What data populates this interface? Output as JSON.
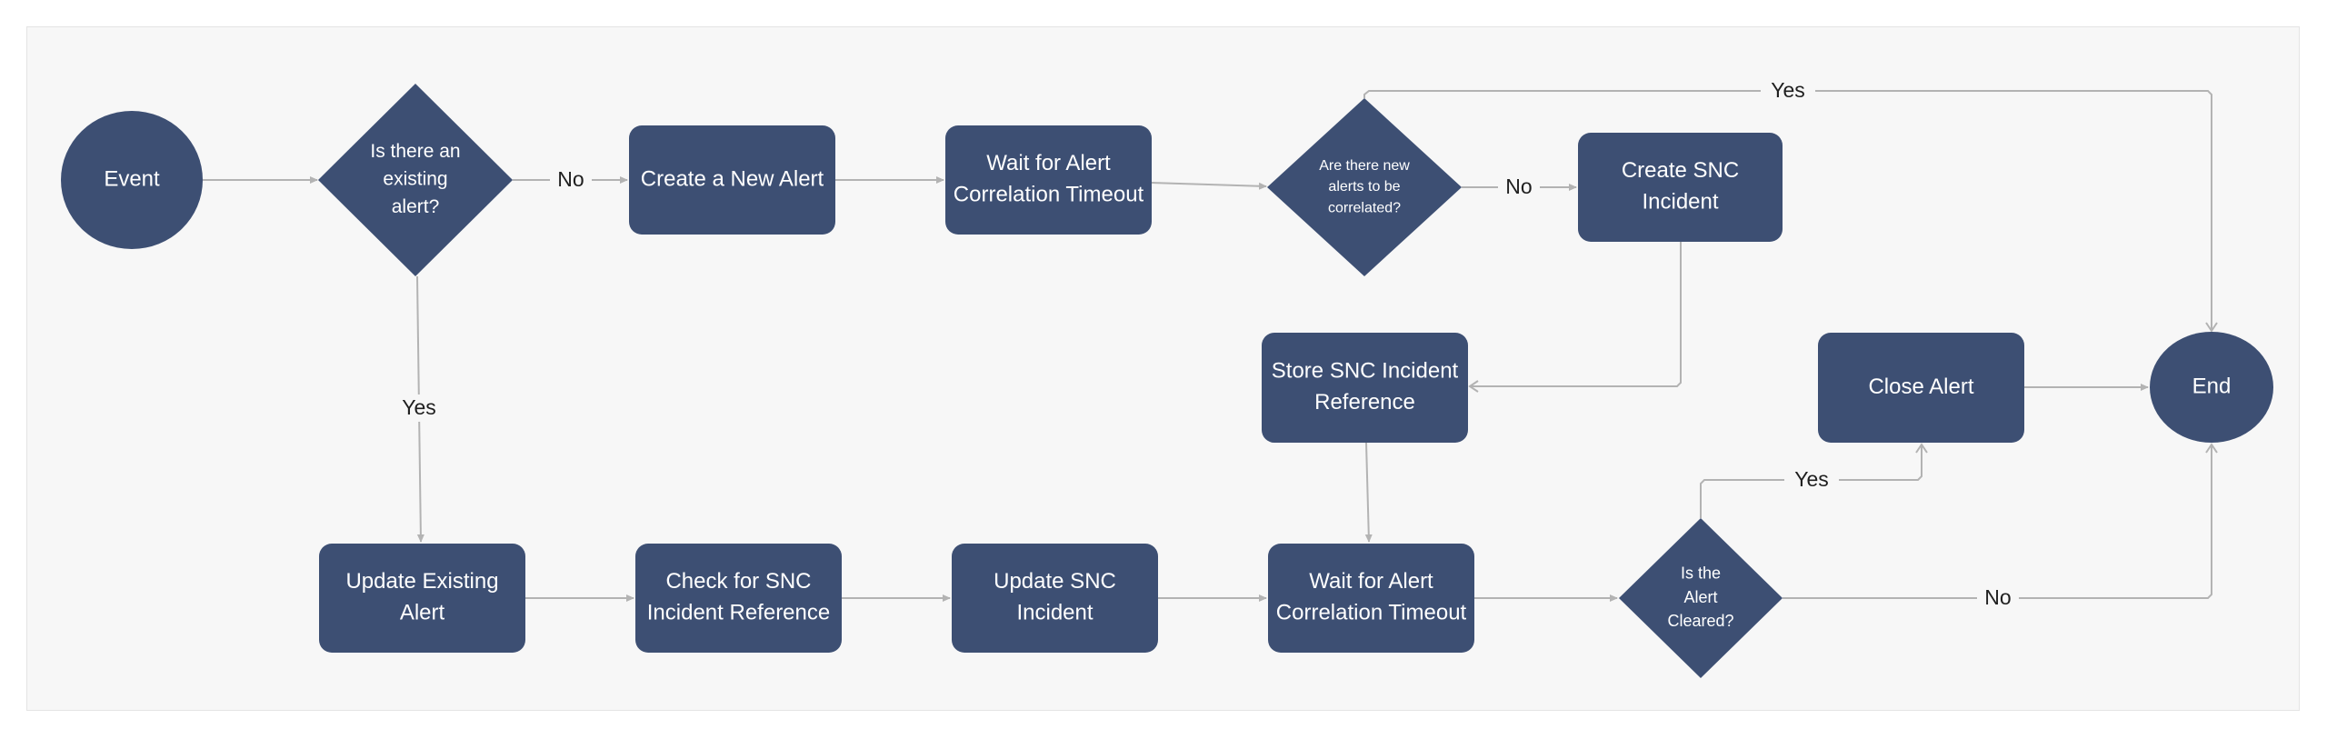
{
  "colors": {
    "node_fill": "#3d4f73",
    "edge": "#b3b3b3",
    "panel_bg": "#f7f7f7",
    "text_on_node": "#ffffff",
    "label_text": "#1f1f1f"
  },
  "nodes": [
    {
      "id": "event",
      "shape": "ellipse",
      "lines": [
        "Event"
      ]
    },
    {
      "id": "existing-alert-decision",
      "shape": "diamond",
      "lines": [
        "Is there an",
        "existing",
        "alert?"
      ]
    },
    {
      "id": "create-new-alert",
      "shape": "box",
      "lines": [
        "Create a New Alert"
      ]
    },
    {
      "id": "wait-correlation-1",
      "shape": "box",
      "lines": [
        "Wait for Alert",
        "Correlation Timeout"
      ]
    },
    {
      "id": "new-alerts-decision",
      "shape": "diamond",
      "lines": [
        "Are there new",
        "alerts to be",
        "correlated?"
      ]
    },
    {
      "id": "create-snc-incident",
      "shape": "box",
      "lines": [
        "Create SNC",
        "Incident"
      ]
    },
    {
      "id": "store-snc-reference",
      "shape": "box",
      "lines": [
        "Store SNC Incident",
        "Reference"
      ]
    },
    {
      "id": "close-alert",
      "shape": "box",
      "lines": [
        "Close Alert"
      ]
    },
    {
      "id": "end",
      "shape": "ellipse",
      "lines": [
        "End"
      ]
    },
    {
      "id": "update-existing-alert",
      "shape": "box",
      "lines": [
        "Update Existing",
        "Alert"
      ]
    },
    {
      "id": "check-snc-reference",
      "shape": "box",
      "lines": [
        "Check for SNC",
        "Incident Reference"
      ]
    },
    {
      "id": "update-snc-incident",
      "shape": "box",
      "lines": [
        "Update SNC",
        "Incident"
      ]
    },
    {
      "id": "wait-correlation-2",
      "shape": "box",
      "lines": [
        "Wait for Alert",
        "Correlation Timeout"
      ]
    },
    {
      "id": "alert-cleared-decision",
      "shape": "diamond",
      "lines": [
        "Is the",
        "Alert",
        "Cleared?"
      ]
    }
  ],
  "edges": [
    {
      "from": "event",
      "to": "existing-alert-decision",
      "label": ""
    },
    {
      "from": "existing-alert-decision",
      "to": "create-new-alert",
      "label": "No"
    },
    {
      "from": "existing-alert-decision",
      "to": "update-existing-alert",
      "label": "Yes"
    },
    {
      "from": "create-new-alert",
      "to": "wait-correlation-1",
      "label": ""
    },
    {
      "from": "wait-correlation-1",
      "to": "new-alerts-decision",
      "label": ""
    },
    {
      "from": "new-alerts-decision",
      "to": "create-snc-incident",
      "label": "No"
    },
    {
      "from": "new-alerts-decision",
      "to": "end",
      "label": "Yes"
    },
    {
      "from": "create-snc-incident",
      "to": "store-snc-reference",
      "label": ""
    },
    {
      "from": "store-snc-reference",
      "to": "wait-correlation-2",
      "label": ""
    },
    {
      "from": "update-existing-alert",
      "to": "check-snc-reference",
      "label": ""
    },
    {
      "from": "check-snc-reference",
      "to": "update-snc-incident",
      "label": ""
    },
    {
      "from": "update-snc-incident",
      "to": "wait-correlation-2",
      "label": ""
    },
    {
      "from": "wait-correlation-2",
      "to": "alert-cleared-decision",
      "label": ""
    },
    {
      "from": "alert-cleared-decision",
      "to": "close-alert",
      "label": "Yes"
    },
    {
      "from": "alert-cleared-decision",
      "to": "end",
      "label": "No"
    },
    {
      "from": "close-alert",
      "to": "end",
      "label": ""
    }
  ]
}
